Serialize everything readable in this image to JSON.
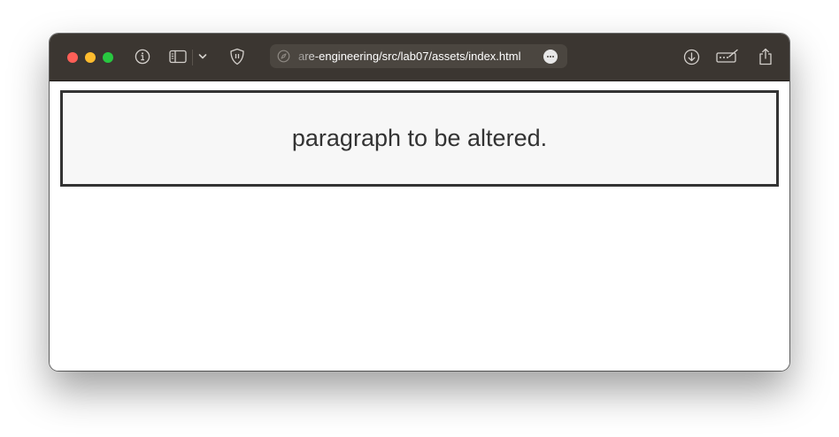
{
  "browser": {
    "address_bar": {
      "url_text": "are-engineering/src/lab07/assets/index.html"
    },
    "icons": {
      "info": "info-icon",
      "sidebar": "sidebar-icon",
      "chevron": "chevron-down-icon",
      "shield": "shield-icon",
      "compass": "compass-icon",
      "more": "more-icon",
      "download": "download-icon",
      "extension": "extension-icon",
      "share": "share-icon"
    }
  },
  "page": {
    "paragraph": "paragraph to be altered."
  },
  "colors": {
    "toolbar": "#3b3631",
    "close": "#ff5f57",
    "minimize": "#febc2e",
    "maximize": "#28c840",
    "box_border": "#333333",
    "box_background": "#f7f7f7"
  }
}
